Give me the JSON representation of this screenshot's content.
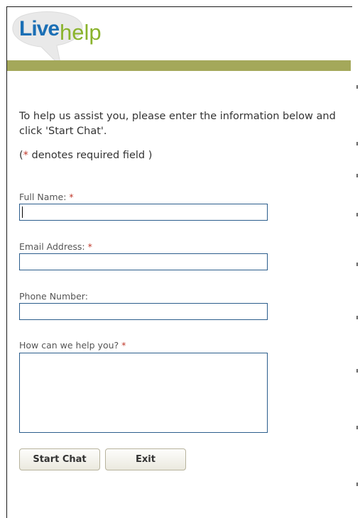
{
  "header": {
    "logo_live": "Live",
    "logo_help": "help"
  },
  "colors": {
    "brand_blue": "#1b6fb5",
    "brand_green": "#8ab32c",
    "bar_olive": "#a4a85a",
    "required_star": "#c0392b",
    "input_border": "#2b5d8c"
  },
  "form": {
    "intro": "To help us assist you, please enter the information below and click 'Start Chat'.",
    "required_note": {
      "prefix": "(",
      "star": "*",
      "text": " denotes required field )"
    },
    "fields": {
      "full_name": {
        "label": "Full Name:",
        "star": "*",
        "value": ""
      },
      "email": {
        "label": "Email Address:",
        "star": "*",
        "value": ""
      },
      "phone": {
        "label": "Phone Number:",
        "value": ""
      },
      "message": {
        "label": "How can we help you?",
        "star": "*",
        "value": ""
      }
    },
    "buttons": {
      "start_chat": "Start Chat",
      "exit": "Exit"
    }
  }
}
